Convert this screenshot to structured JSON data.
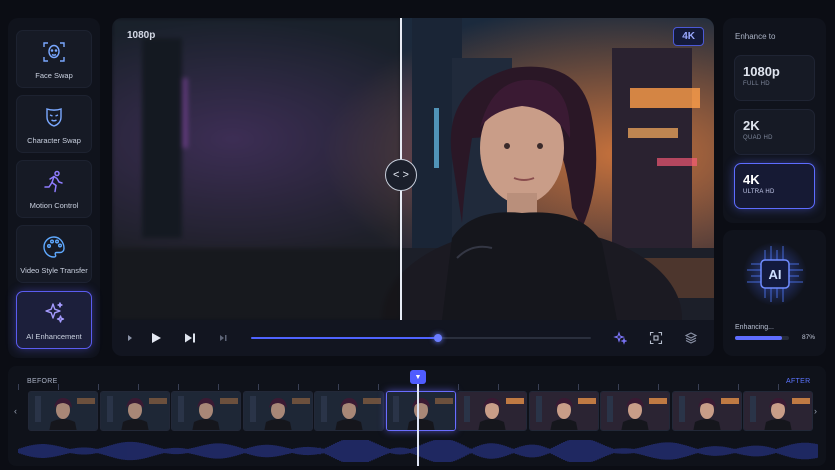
{
  "sidebar": {
    "items": [
      {
        "label": "Face Swap",
        "icon": "face-scan-icon"
      },
      {
        "label": "Character Swap",
        "icon": "mask-icon"
      },
      {
        "label": "Motion Control",
        "icon": "running-figure-icon"
      },
      {
        "label": "Video Style Transfer",
        "icon": "palette-icon"
      },
      {
        "label": "AI Enhancement",
        "icon": "sparkles-icon",
        "active": true
      }
    ]
  },
  "preview": {
    "before_label": "1080p",
    "after_label": "4K",
    "divider_handle": "< >",
    "progress": 0.55
  },
  "enhance": {
    "title": "Enhance to",
    "options": [
      {
        "main": "1080p",
        "sub": "FULL HD"
      },
      {
        "main": "2K",
        "sub": "QUAD HD"
      },
      {
        "main": "4K",
        "sub": "ULTRA HD",
        "active": true
      }
    ]
  },
  "ai": {
    "chip_label": "AI",
    "status": "Enhancing...",
    "percent_text": "87%",
    "percent": 87
  },
  "timeline": {
    "before_label": "BEFORE",
    "after_label": "AFTER",
    "frame_count": 11,
    "selected_frame": 5
  },
  "colors": {
    "accent": "#5b5cf0",
    "background": "#0b0d14",
    "panel": "#10131c"
  }
}
